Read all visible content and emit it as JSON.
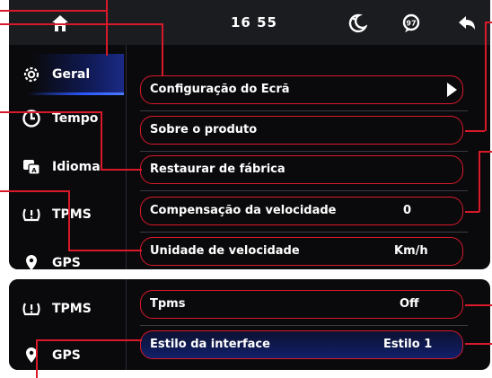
{
  "topbar": {
    "clock": "16 55",
    "icons": [
      "home-icon",
      "moon-icon",
      "chat-bubble-icon",
      "back-arrow-icon"
    ]
  },
  "sidebar_top": {
    "items": [
      {
        "label": "Geral",
        "icon": "gear-icon",
        "active": true
      },
      {
        "label": "Tempo",
        "icon": "clock-icon"
      },
      {
        "label": "Idioma",
        "icon": "language-icon"
      },
      {
        "label": "TPMS",
        "icon": "tire-pressure-icon"
      },
      {
        "label": "GPS",
        "icon": "gps-icon"
      }
    ]
  },
  "settings_top": {
    "rows": [
      {
        "label": "Configuração do Ecrã",
        "value": ""
      },
      {
        "label": "Sobre o produto",
        "value": ""
      },
      {
        "label": "Restaurar de fábrica",
        "value": ""
      },
      {
        "label": "Compensação da velocidade",
        "value": "0"
      },
      {
        "label": "Unidade de velocidade",
        "value": "Km/h"
      }
    ]
  },
  "sidebar_bottom": {
    "items": [
      {
        "label": "TPMS",
        "icon": "tire-pressure-icon"
      },
      {
        "label": "GPS",
        "icon": "gps-icon"
      }
    ]
  },
  "settings_bottom": {
    "rows": [
      {
        "label": "Tpms",
        "value": "Off"
      },
      {
        "label": "Estilo da interface",
        "value": "Estilo 1"
      }
    ]
  },
  "colors": {
    "annotation_red": "#d8192a",
    "active_blue": "#1b2a86",
    "background": "#0a0a0c"
  }
}
